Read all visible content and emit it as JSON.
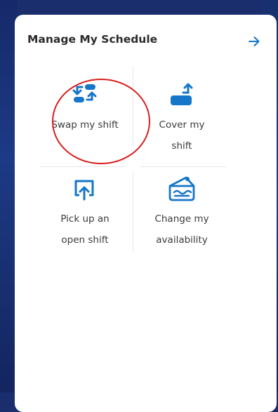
{
  "card": {
    "title": "Manage My Schedule",
    "header_icon": "arrow-right-icon"
  },
  "actions": [
    {
      "label": "Swap my shift",
      "icon": "swap-shift-icon"
    },
    {
      "label": "Cover my shift",
      "icon": "cover-shift-icon"
    },
    {
      "label": "Pick up an open shift",
      "icon": "pickup-shift-icon"
    },
    {
      "label": "Change my availability",
      "icon": "calendar-availability-icon"
    }
  ],
  "colors": {
    "accent": "#1676c9",
    "background": "#1a2e6e",
    "annotation": "#d81e1e"
  }
}
